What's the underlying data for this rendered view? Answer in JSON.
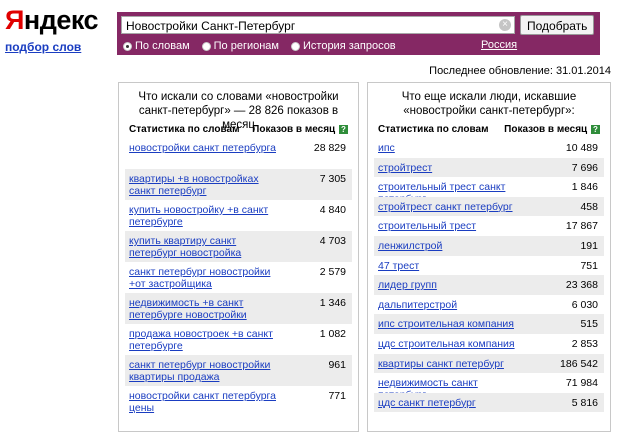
{
  "logo": {
    "first_letter": "Я",
    "rest": "ндекс",
    "sub": "подбор слов"
  },
  "search": {
    "query": "Новостройки Санкт-Петербург",
    "button": "Подобрать",
    "clear": "×"
  },
  "modes": [
    {
      "label": "По словам",
      "checked": true
    },
    {
      "label": "По регионам",
      "checked": false
    },
    {
      "label": "История запросов",
      "checked": false
    }
  ],
  "region": "Россия",
  "last_update": "Последнее обновление: 31.01.2014",
  "left": {
    "title": "Что искали со словами «новостройки санкт-петербург» — 28 826 показов в месяц",
    "col1": "Статистика по словам",
    "col2": "Показов в месяц",
    "help": "?",
    "rows": [
      {
        "phrase": "новостройки санкт петербурга",
        "count": "28 829"
      },
      {
        "phrase": "квартиры +в новостройках санкт петербург",
        "count": "7 305"
      },
      {
        "phrase": "купить новостройку +в санкт петербурге",
        "count": "4 840"
      },
      {
        "phrase": "купить квартиру санкт петербург новостройка",
        "count": "4 703"
      },
      {
        "phrase": "санкт петербург новостройки +от застройщика",
        "count": "2 579"
      },
      {
        "phrase": "недвижимость +в санкт петербурге новостройки",
        "count": "1 346"
      },
      {
        "phrase": "продажа новостроек +в санкт петербурге",
        "count": "1 082"
      },
      {
        "phrase": "санкт петербург новостройки квартиры продажа",
        "count": "961"
      },
      {
        "phrase": "новостройки санкт петербурга цены",
        "count": "771"
      }
    ]
  },
  "right": {
    "title": "Что еще искали люди, искавшие «новостройки санкт-петербург»:",
    "col1": "Статистика по словам",
    "col2": "Показов в месяц",
    "help": "?",
    "rows": [
      {
        "phrase": "ипс",
        "count": "10 489"
      },
      {
        "phrase": "стройтрест",
        "count": "7 696"
      },
      {
        "phrase": "строительный трест санкт петербург",
        "count": "1 846"
      },
      {
        "phrase": "стройтрест санкт петербург",
        "count": "458"
      },
      {
        "phrase": "строительный трест",
        "count": "17 867"
      },
      {
        "phrase": "ленжилстрой",
        "count": "191"
      },
      {
        "phrase": "47 трест",
        "count": "751"
      },
      {
        "phrase": "лидер групп",
        "count": "23 368"
      },
      {
        "phrase": "дальпитерстрой",
        "count": "6 030"
      },
      {
        "phrase": "ипс строительная компания",
        "count": "515"
      },
      {
        "phrase": "цдс строительная компания",
        "count": "2 853"
      },
      {
        "phrase": "квартиры санкт петербург",
        "count": "186 542"
      },
      {
        "phrase": "недвижимость санкт петербург",
        "count": "71 984"
      },
      {
        "phrase": "цдс санкт петербург",
        "count": "5 816"
      }
    ]
  }
}
